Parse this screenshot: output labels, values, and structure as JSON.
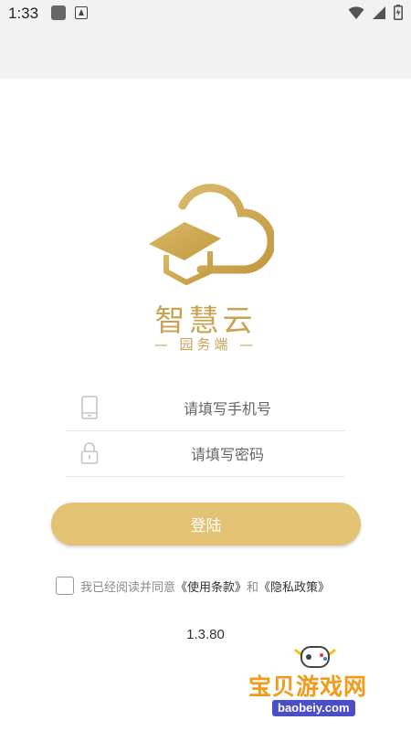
{
  "status_bar": {
    "time": "1:33",
    "icons": [
      "app-square-icon",
      "font-a-icon",
      "wifi-icon",
      "signal-icon",
      "battery-icon"
    ]
  },
  "brand": {
    "name": "智慧云",
    "subtitle": "— 园务端 —",
    "color": "#c9a253"
  },
  "form": {
    "phone_placeholder": "请填写手机号",
    "phone_value": "",
    "password_placeholder": "请填写密码",
    "password_value": "",
    "phone_icon": "phone-icon",
    "password_icon": "lock-icon"
  },
  "login": {
    "label": "登陆",
    "color": "#e3c274"
  },
  "agreement": {
    "checked": false,
    "prefix": "我已经阅读并同意",
    "terms_link": "《使用条款》",
    "conjunction": "和",
    "privacy_link": "《隐私政策》"
  },
  "version": "1.3.80",
  "watermark": {
    "title": "宝贝游戏网",
    "url": "baobeiy.com"
  }
}
